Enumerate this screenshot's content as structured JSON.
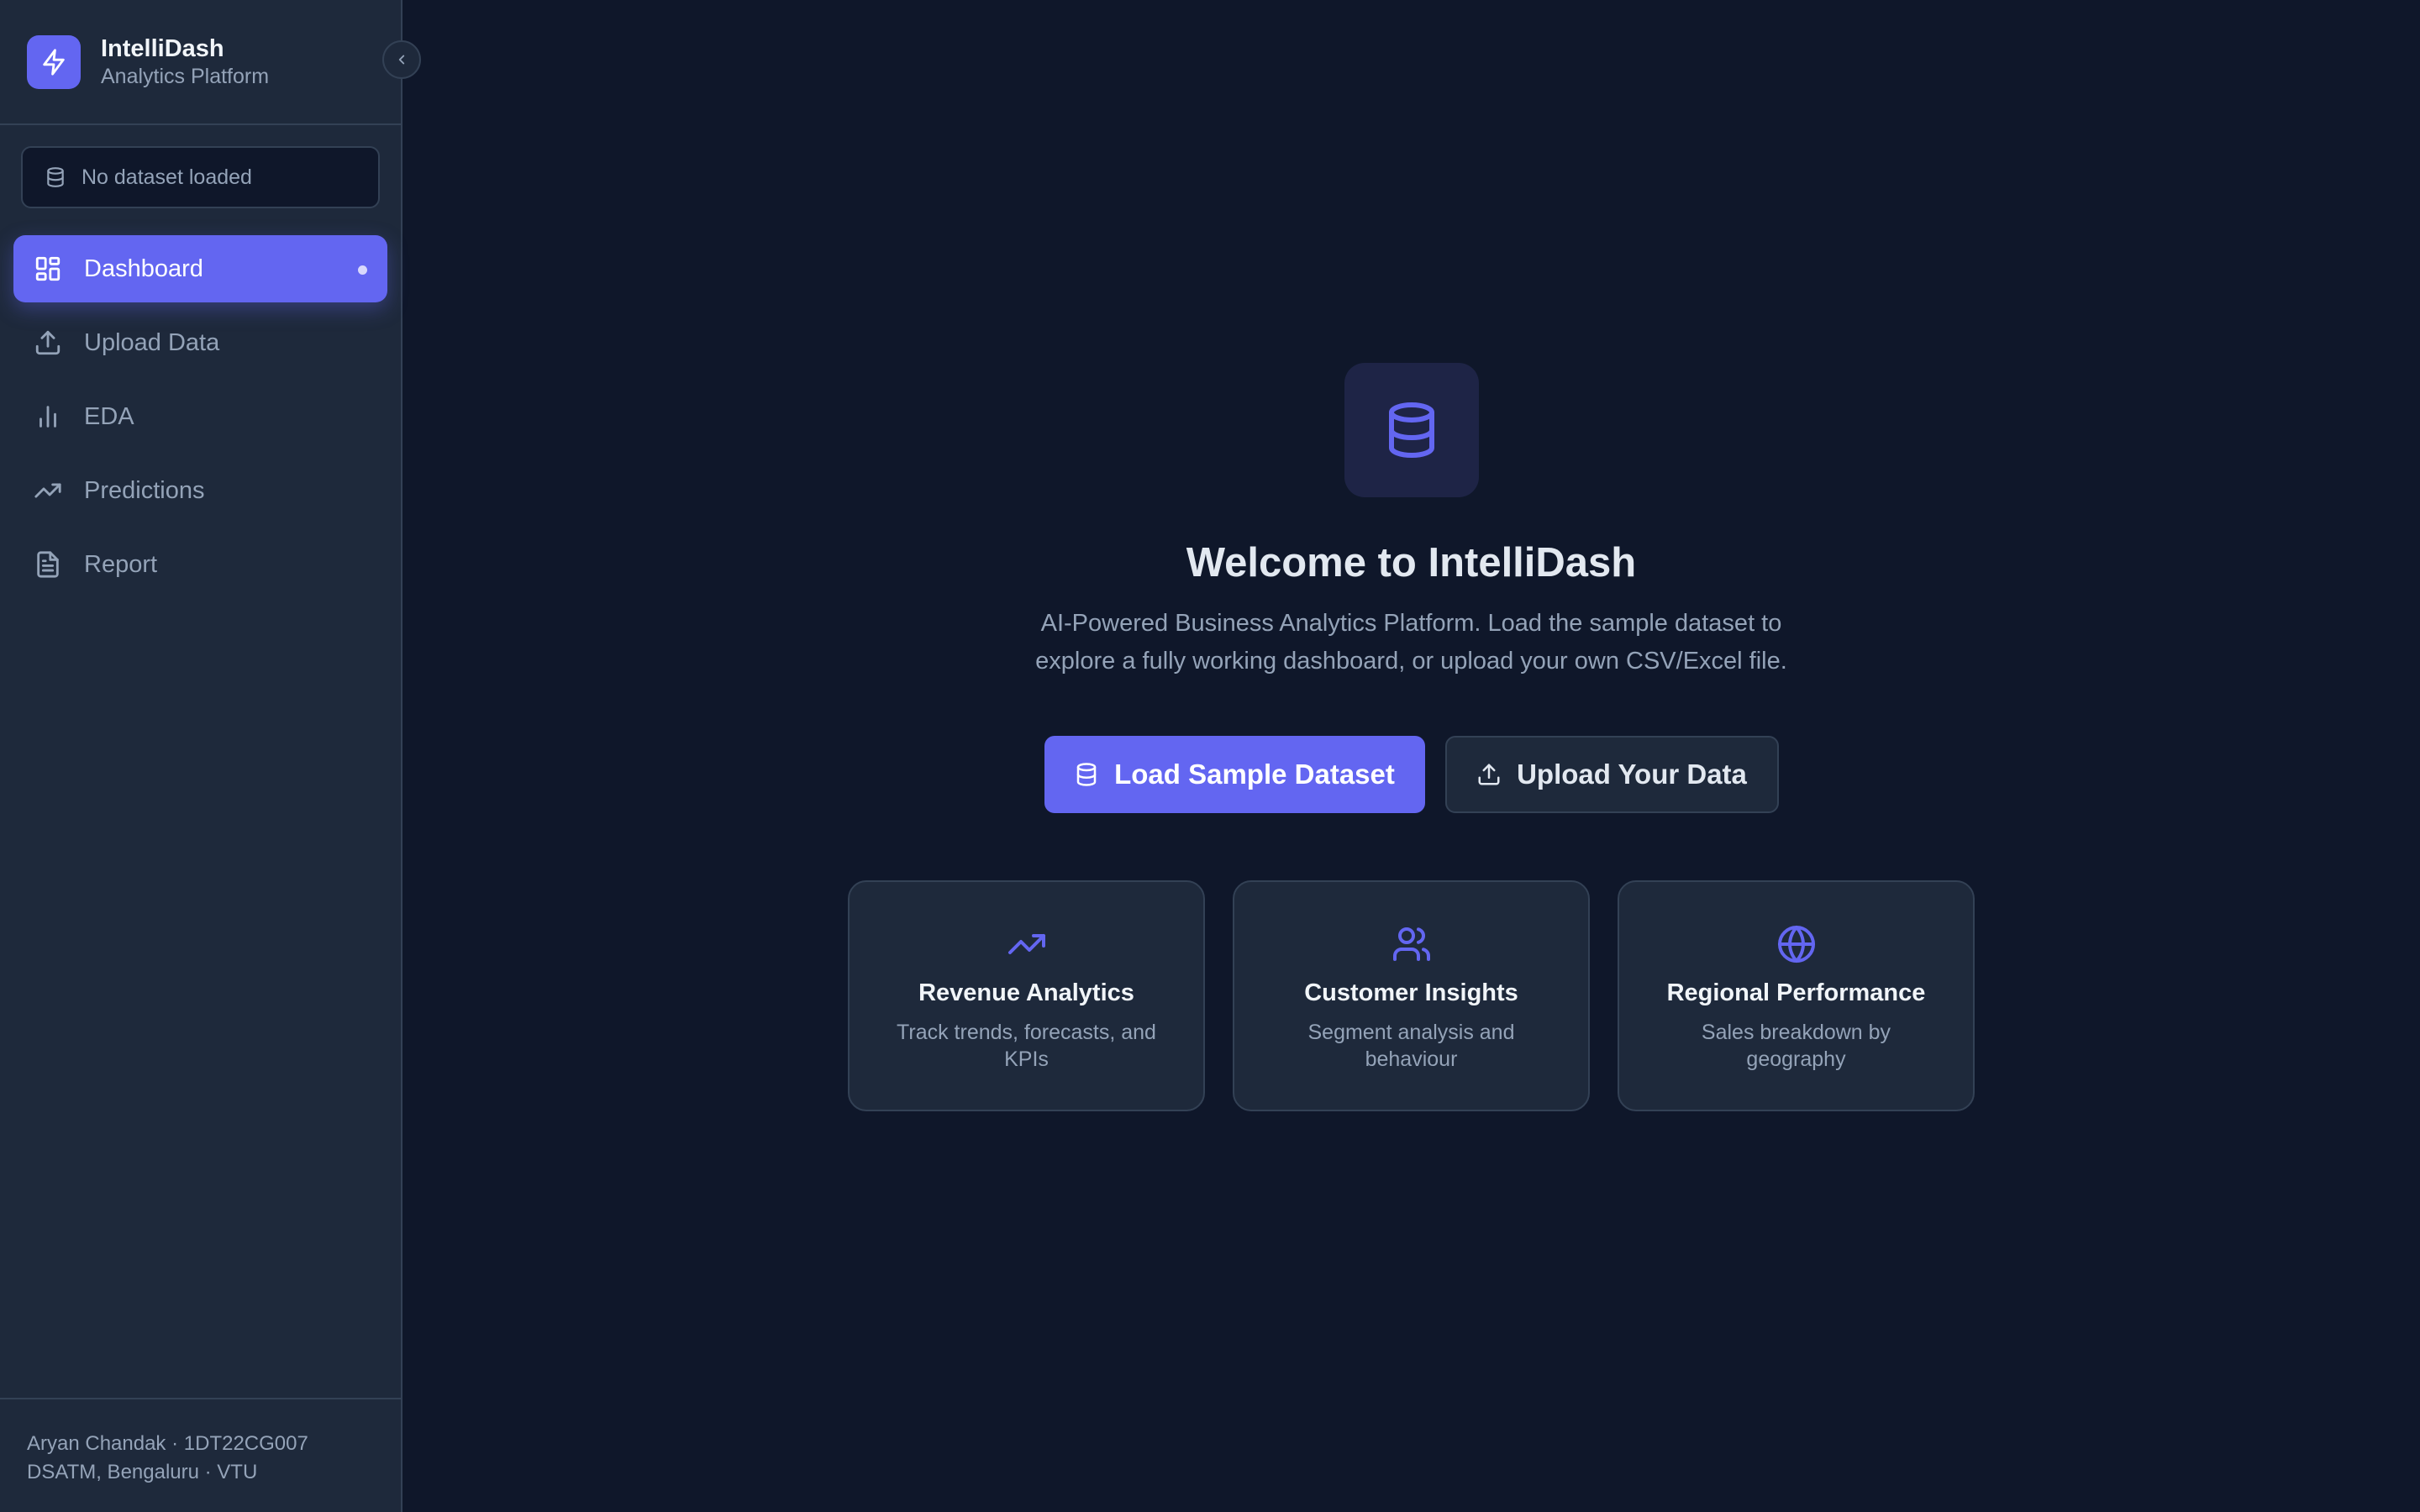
{
  "brand": {
    "name": "IntelliDash",
    "subtitle": "Analytics Platform"
  },
  "dataset_status": "No dataset loaded",
  "nav": {
    "items": [
      {
        "label": "Dashboard",
        "icon": "layout-dashboard-icon",
        "active": true
      },
      {
        "label": "Upload Data",
        "icon": "upload-icon",
        "active": false
      },
      {
        "label": "EDA",
        "icon": "bar-chart-icon",
        "active": false
      },
      {
        "label": "Predictions",
        "icon": "trending-up-icon",
        "active": false
      },
      {
        "label": "Report",
        "icon": "file-text-icon",
        "active": false
      }
    ]
  },
  "footer": {
    "line1": "Aryan Chandak · 1DT22CG007",
    "line2": "DSATM, Bengaluru · VTU"
  },
  "hero": {
    "title": "Welcome to IntelliDash",
    "description": "AI-Powered Business Analytics Platform. Load the sample dataset to explore a fully working dashboard, or upload your own CSV/Excel file."
  },
  "actions": {
    "primary_label": "Load Sample Dataset",
    "secondary_label": "Upload Your Data"
  },
  "features": [
    {
      "title": "Revenue Analytics",
      "description": "Track trends, forecasts, and KPIs",
      "icon": "trending-up-icon"
    },
    {
      "title": "Customer Insights",
      "description": "Segment analysis and behaviour",
      "icon": "users-icon"
    },
    {
      "title": "Regional Performance",
      "description": "Sales breakdown by geography",
      "icon": "globe-icon"
    }
  ],
  "colors": {
    "accent": "#6366f1",
    "background": "#0f172a",
    "sidebar": "#1e293b",
    "border": "#334155",
    "muted_text": "#94a3b8"
  }
}
